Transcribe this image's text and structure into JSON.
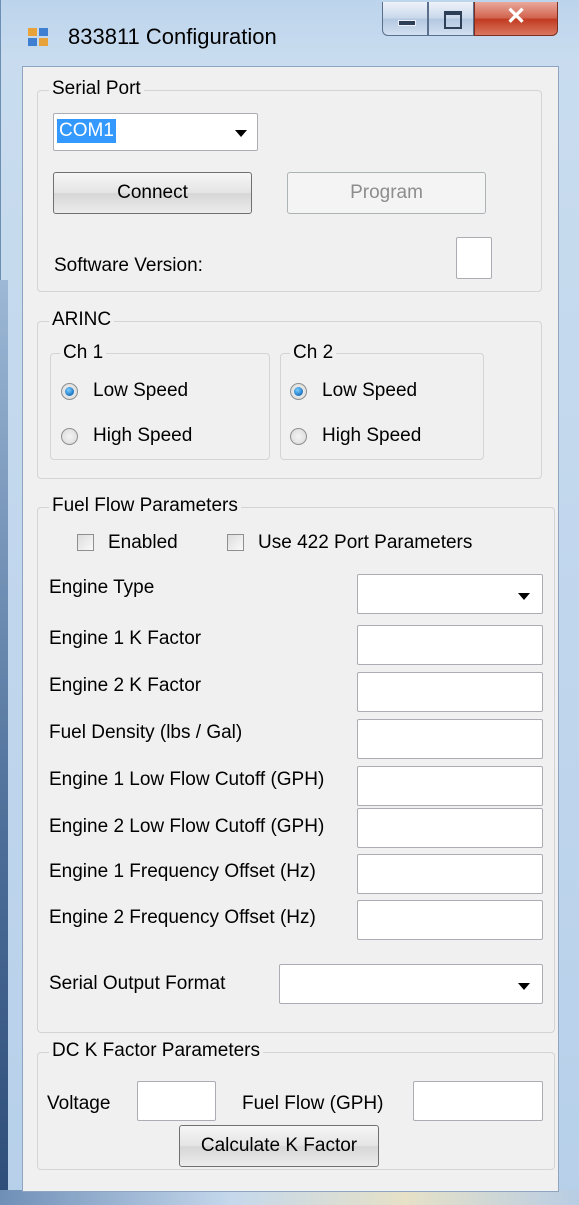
{
  "window": {
    "title": "833811 Configuration"
  },
  "serial_port": {
    "legend": "Serial Port",
    "com_value": "COM1",
    "connect_label": "Connect",
    "program_label": "Program",
    "software_version_label": "Software Version:",
    "software_version_value": ""
  },
  "arinc": {
    "legend": "ARINC",
    "ch1": {
      "legend": "Ch 1",
      "low_label": "Low Speed",
      "high_label": "High Speed",
      "selected": "Low Speed"
    },
    "ch2": {
      "legend": "Ch 2",
      "low_label": "Low Speed",
      "high_label": "High Speed",
      "selected": "Low Speed"
    }
  },
  "fuel_flow": {
    "legend": "Fuel Flow Parameters",
    "enabled_label": "Enabled",
    "use422_label": "Use 422 Port Parameters",
    "engine_type_label": "Engine Type",
    "engine1_k_label": "Engine 1 K Factor",
    "engine2_k_label": "Engine 2 K Factor",
    "fuel_density_label": "Fuel Density (lbs / Gal)",
    "engine1_cutoff_label": "Engine 1 Low Flow Cutoff (GPH)",
    "engine2_cutoff_label": "Engine 2 Low Flow Cutoff (GPH)",
    "engine1_freq_label": "Engine 1 Frequency Offset (Hz)",
    "engine2_freq_label": "Engine 2 Frequency Offset (Hz)",
    "serial_output_label": "Serial Output Format"
  },
  "dc_k": {
    "legend": "DC K Factor Parameters",
    "voltage_label": "Voltage",
    "fuel_flow_label": "Fuel Flow (GPH)",
    "calc_label": "Calculate K Factor"
  },
  "colors": {
    "selection": "#3399ff",
    "close_button": "#c7402a"
  }
}
